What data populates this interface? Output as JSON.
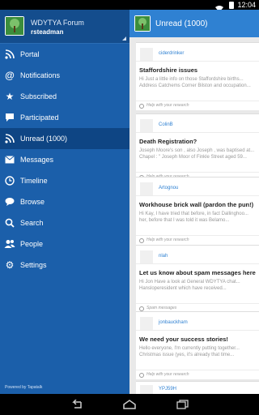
{
  "status_bar": {
    "time": "12:04"
  },
  "drawer": {
    "forum_title": "WDYTYA Forum",
    "username": "rsteadman",
    "footer": "Powered by Tapatalk",
    "items": [
      {
        "label": "Portal",
        "icon": "rss-icon"
      },
      {
        "label": "Notifications",
        "icon": "at-icon"
      },
      {
        "label": "Subscribed",
        "icon": "star-icon"
      },
      {
        "label": "Participated",
        "icon": "speech-bubble-icon"
      },
      {
        "label": "Unread (1000)",
        "icon": "unread-feed-icon"
      },
      {
        "label": "Messages",
        "icon": "mail-icon"
      },
      {
        "label": "Timeline",
        "icon": "clock-icon"
      },
      {
        "label": "Browse",
        "icon": "chat-bubbles-icon"
      },
      {
        "label": "Search",
        "icon": "search-icon"
      },
      {
        "label": "People",
        "icon": "people-icon"
      },
      {
        "label": "Settings",
        "icon": "gear-icon"
      }
    ]
  },
  "main": {
    "title": "Unread (1000)",
    "cards": [
      {
        "author": "ciderdrinker",
        "topic": "Staffordshire issues",
        "preview_1": "Hi Just a little info on those Staffordshire births...",
        "preview_2": "Address Catchems Corner Bilston and occupation...",
        "forum": "Help with your research"
      },
      {
        "author": "ColinB",
        "topic": "Death Registration?",
        "preview_1": "Joseph Moore's son , also Joseph , was baptised at...",
        "preview_2": "Chapel : \" Joseph Moor of Finkle Street aged 59...",
        "forum": "Help with your research"
      },
      {
        "author": "Artognou",
        "topic": "Workhouse brick wall (pardon the pun!)",
        "preview_1": "Hi Kay, I have tried that before, in fact Dallinghoo...",
        "preview_2": "her, before that I was told it was Belamo...",
        "forum": "Help with your research"
      },
      {
        "author": "nlah",
        "topic": "Let us know about spam messages here",
        "preview_1": "Hi Jon Have a look at General WDYTYA chat...",
        "preview_2": "Hansloperesident which have received...",
        "forum": "Spam messages"
      },
      {
        "author": "jonbauckham",
        "topic": "We need your success stories!",
        "preview_1": "Hello everyone, I'm currently putting together...",
        "preview_2": "Christmas issue (yes, it's already that time...",
        "forum": "Help with your research"
      },
      {
        "author": "YPJ59H",
        "topic": "",
        "preview_1": "",
        "preview_2": "",
        "forum": ""
      }
    ]
  },
  "colors": {
    "drawer_bg": "#1b5faa",
    "drawer_active": "#0e4584",
    "topbar": "#2f81d2",
    "author_link": "#2f81d2"
  }
}
